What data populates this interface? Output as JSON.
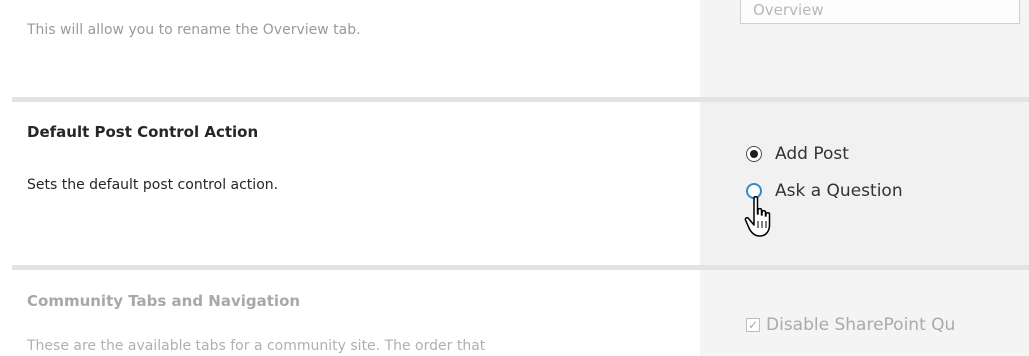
{
  "overview": {
    "description": "This will allow you to rename the Overview tab.",
    "input_value": "Overview"
  },
  "post_control": {
    "title": "Default Post Control Action",
    "description": "Sets the default post control action.",
    "options": [
      {
        "label": "Add Post",
        "selected": true
      },
      {
        "label": "Ask a Question",
        "selected": false,
        "hovered": true
      }
    ]
  },
  "community_tabs": {
    "title": "Community Tabs and Navigation",
    "description": "These are the available tabs for a community site. The order that",
    "checkbox_label": "Disable SharePoint Qu",
    "checkbox_checked": true
  },
  "icons": {
    "cursor": "hand-pointer-icon"
  },
  "colors": {
    "radio_hover": "#2a8dd4",
    "panel_bg": "#f1f1f1"
  }
}
